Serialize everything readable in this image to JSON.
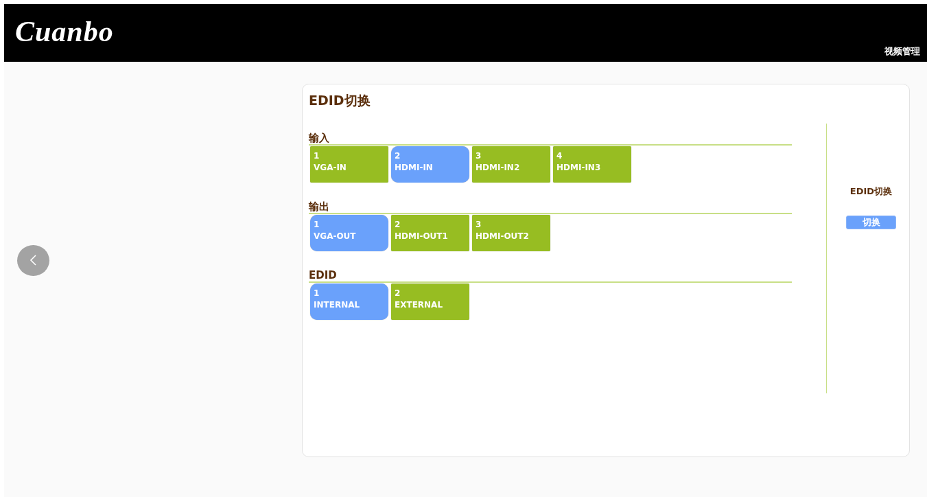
{
  "header": {
    "logo": "Cuanbo",
    "nav": "视频管理"
  },
  "panel": {
    "title": "EDID切换",
    "groups": [
      {
        "label": "输入",
        "tiles": [
          {
            "number": "1",
            "name": "VGA-IN",
            "selected": false
          },
          {
            "number": "2",
            "name": "HDMI-IN",
            "selected": true
          },
          {
            "number": "3",
            "name": "HDMI-IN2",
            "selected": false
          },
          {
            "number": "4",
            "name": "HDMI-IN3",
            "selected": false
          }
        ]
      },
      {
        "label": "输出",
        "tiles": [
          {
            "number": "1",
            "name": "VGA-OUT",
            "selected": true
          },
          {
            "number": "2",
            "name": "HDMI-OUT1",
            "selected": false
          },
          {
            "number": "3",
            "name": "HDMI-OUT2",
            "selected": false
          }
        ]
      },
      {
        "label": "EDID",
        "tiles": [
          {
            "number": "1",
            "name": "INTERNAL",
            "selected": true
          },
          {
            "number": "2",
            "name": "EXTERNAL",
            "selected": false
          }
        ]
      }
    ],
    "side": {
      "label": "EDID切换",
      "button": "切换"
    }
  }
}
